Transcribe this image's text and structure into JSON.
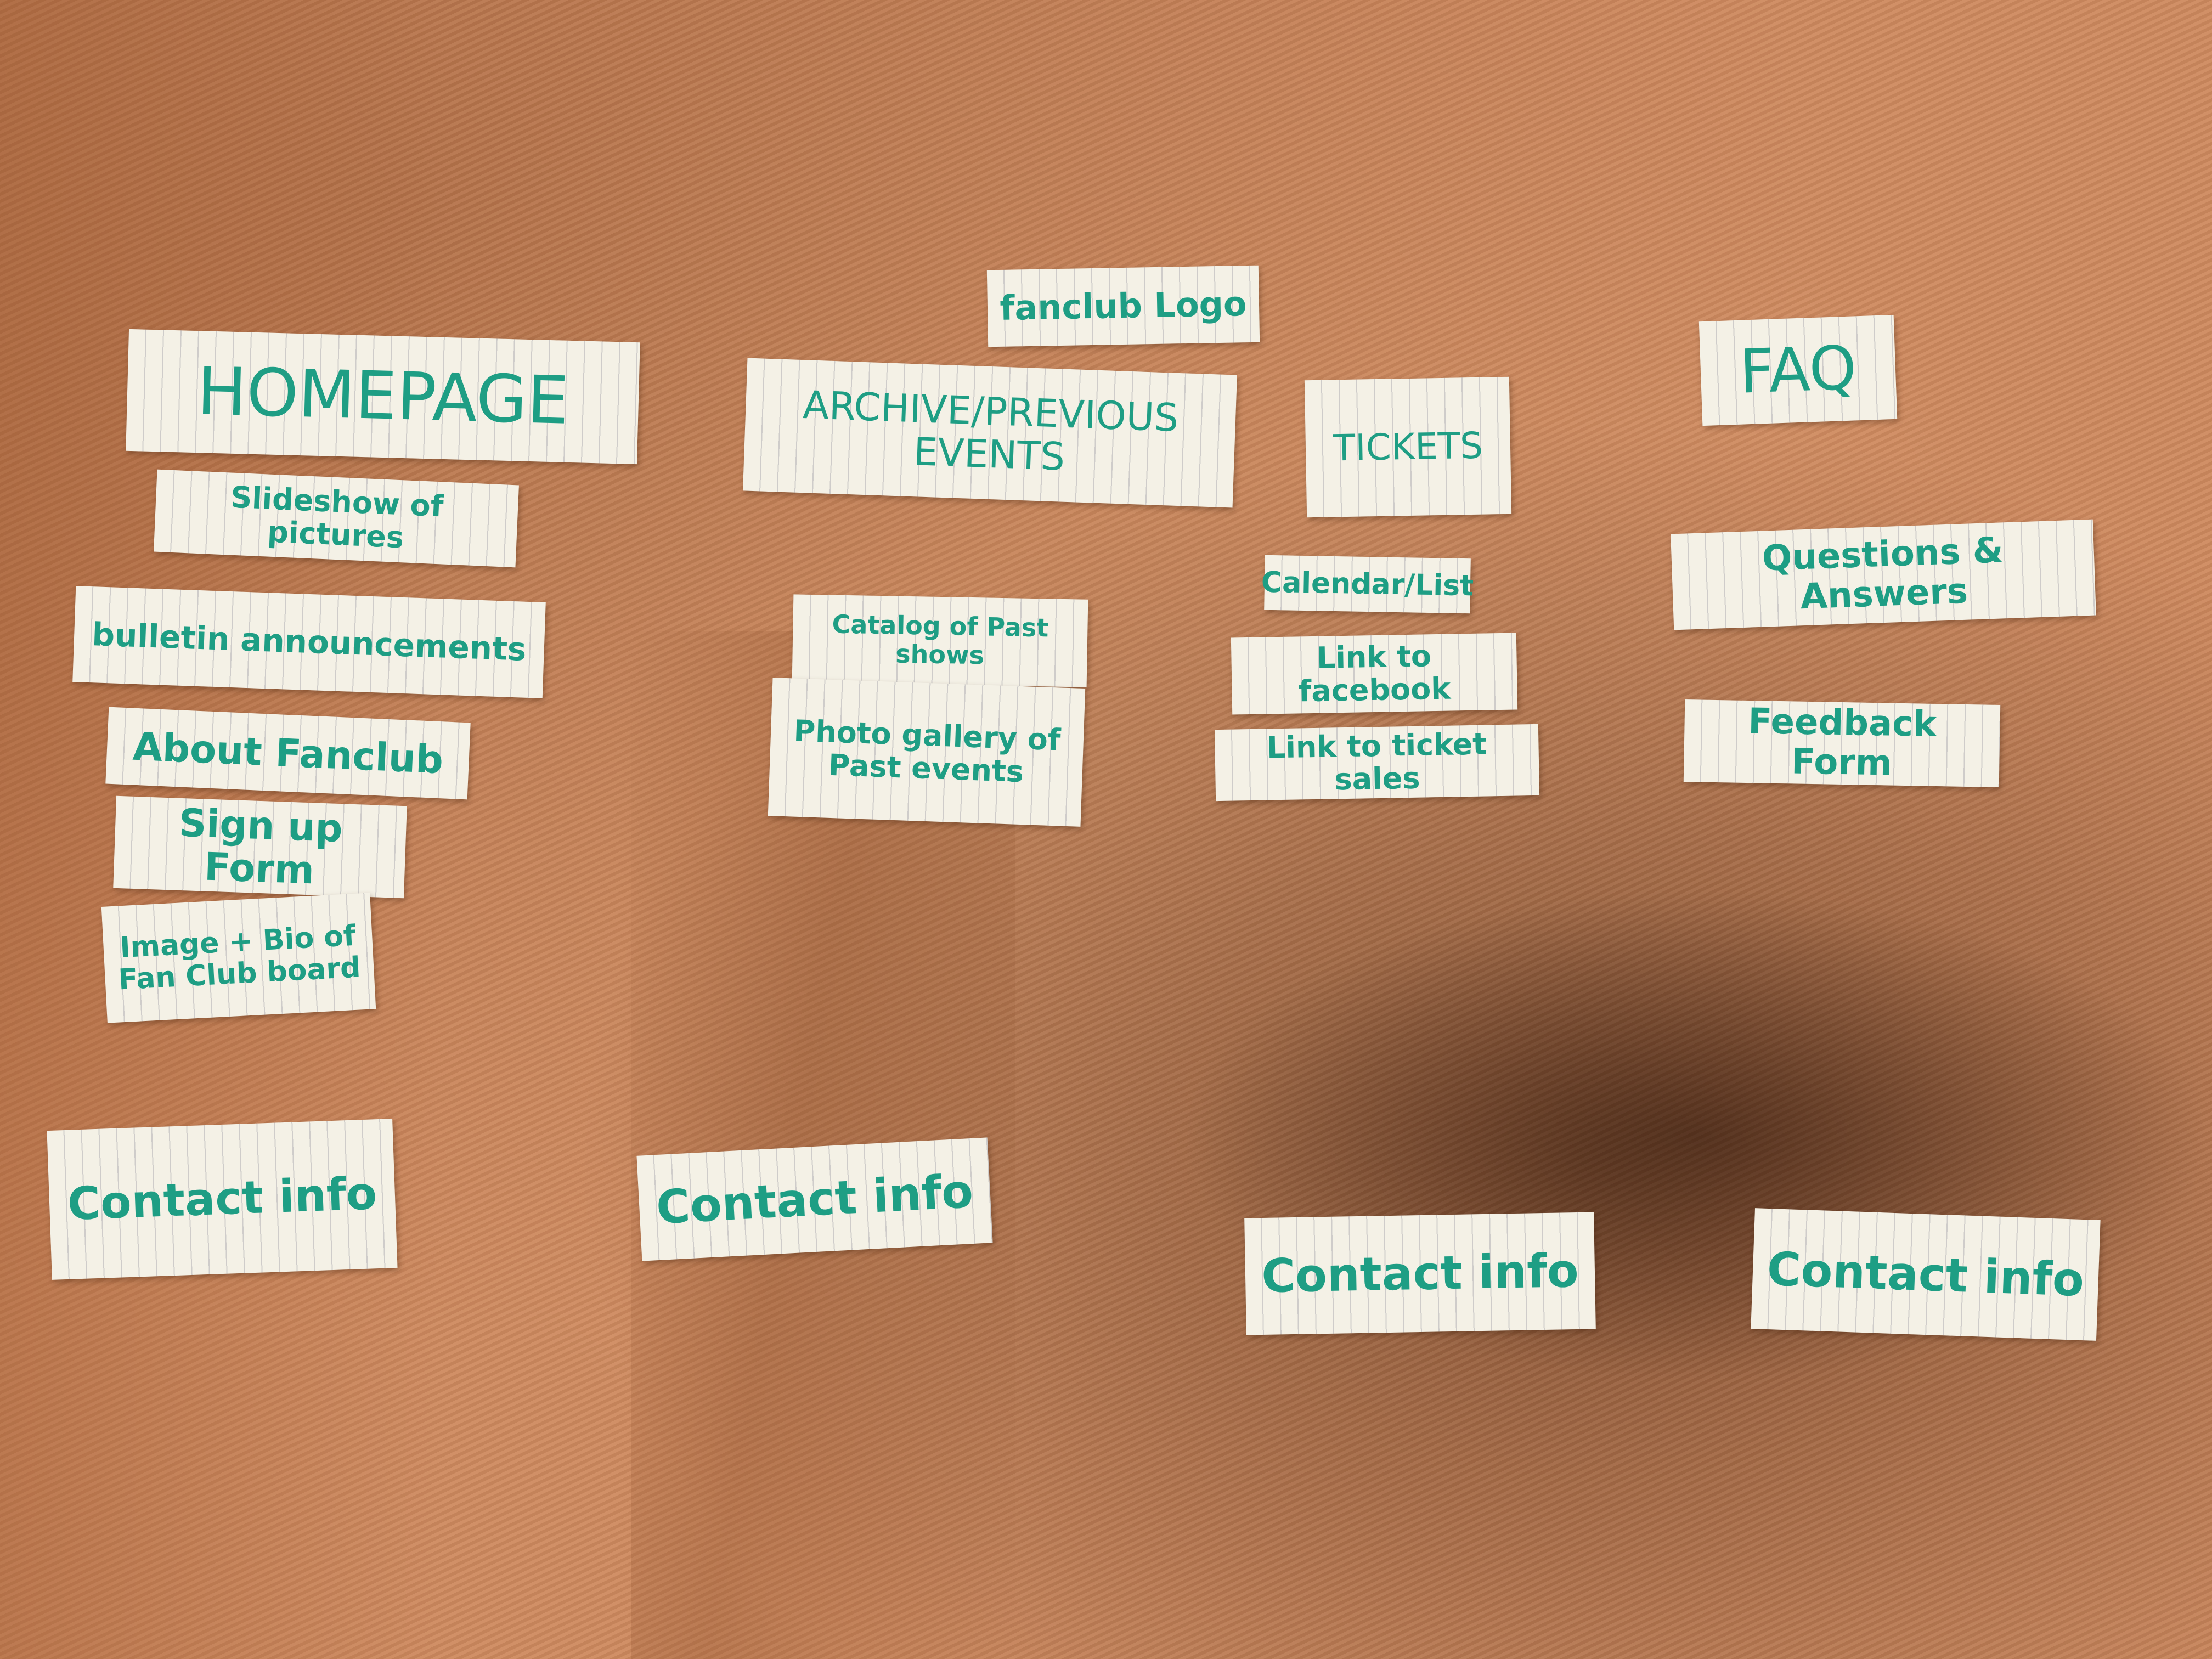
{
  "colors": {
    "fabric": "#cf8a5f",
    "paper": "#f4f1e6",
    "marker_ink": "#1e9e84"
  },
  "logo_note": "fanclub Logo",
  "columns": {
    "homepage": {
      "heading": "HOMEPAGE",
      "items": [
        "Slideshow of pictures",
        "bulletin announcements",
        "About Fanclub",
        "Sign up Form",
        "Image + Bio of Fan Club board"
      ],
      "contact": "Contact info"
    },
    "archive": {
      "heading": "ARCHIVE/PREVIOUS EVENTS",
      "items": [
        "Catalog of Past shows",
        "Photo gallery of Past events"
      ],
      "contact": "Contact info"
    },
    "tickets": {
      "heading": "TICKETS",
      "items": [
        "Calendar/List",
        "Link to facebook",
        "Link to ticket sales"
      ],
      "contact": "Contact info"
    },
    "faq": {
      "heading": "FAQ",
      "items": [
        "Questions & Answers",
        "Feedback Form"
      ],
      "contact": "Contact info"
    }
  }
}
